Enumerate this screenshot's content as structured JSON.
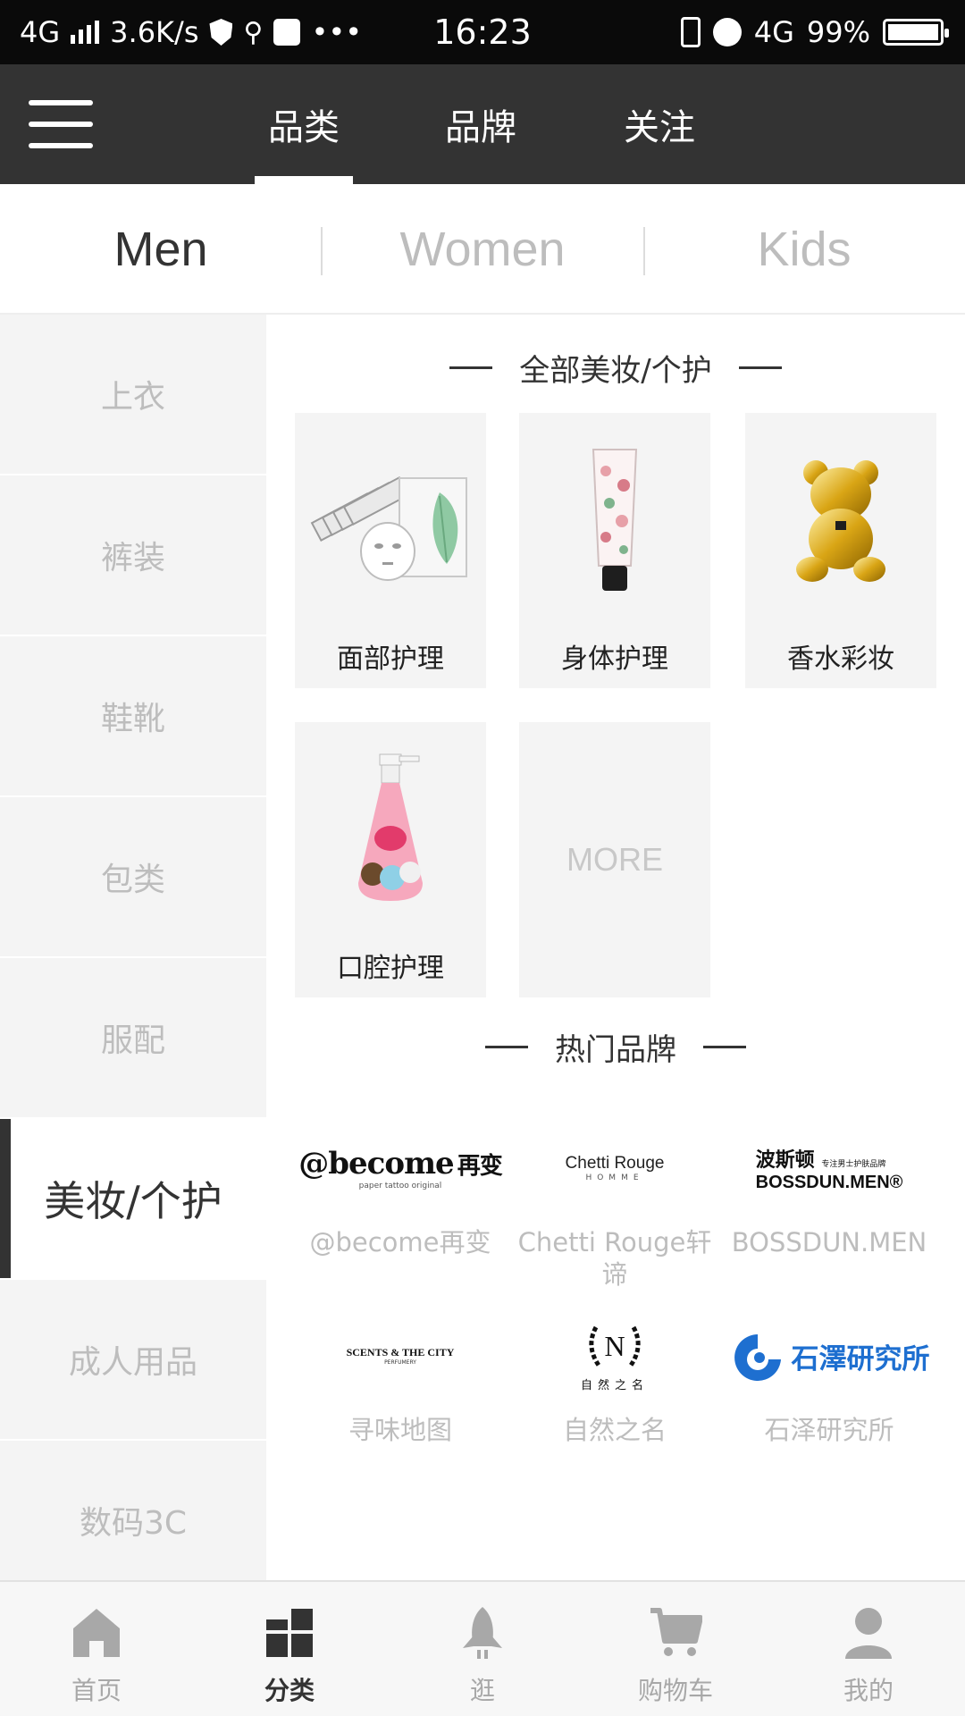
{
  "status_bar": {
    "network": "4G",
    "speed": "3.6K/s",
    "more": "•••",
    "time": "16:23",
    "network_right": "4G",
    "battery": "99%"
  },
  "top_nav": {
    "tabs": [
      {
        "label": "品类",
        "active": true
      },
      {
        "label": "品牌",
        "active": false
      },
      {
        "label": "关注",
        "active": false
      }
    ]
  },
  "gender_tabs": [
    {
      "label": "Men",
      "active": true
    },
    {
      "label": "Women",
      "active": false
    },
    {
      "label": "Kids",
      "active": false
    }
  ],
  "sidebar": {
    "items": [
      {
        "label": "上衣"
      },
      {
        "label": "裤装"
      },
      {
        "label": "鞋靴"
      },
      {
        "label": "包类"
      },
      {
        "label": "服配"
      },
      {
        "label": "美妆/个护",
        "active": true
      },
      {
        "label": "成人用品"
      },
      {
        "label": "数码3C"
      }
    ]
  },
  "main": {
    "category_section_title": "全部美妆/个护",
    "categories": [
      {
        "label": "面部护理",
        "image": "face-mask-product"
      },
      {
        "label": "身体护理",
        "image": "hand-cream-tube"
      },
      {
        "label": "香水彩妆",
        "image": "gold-bear-perfume"
      },
      {
        "label": "口腔护理",
        "image": "toothpaste-pump-bottle"
      }
    ],
    "more_label": "MORE",
    "brands_section_title": "热门品牌",
    "brands": [
      {
        "name": "@become再变",
        "logo_text": "@become",
        "logo_cn": "再变",
        "logo_sub": "paper tattoo original"
      },
      {
        "name": "Chetti Rouge轩谛",
        "logo_text": "Chetti Rouge",
        "logo_sub": "HOMME"
      },
      {
        "name": "BOSSDUN.MEN",
        "logo_text": "BOSSDUN.MEN®",
        "logo_cn": "波斯顿",
        "logo_sub": "专注男士护肤品牌"
      },
      {
        "name": "寻味地图",
        "logo_text": "SCENTS & THE CITY",
        "logo_sub": "PERFUMERY"
      },
      {
        "name": "自然之名",
        "logo_text": "N",
        "logo_cn": "自然之名"
      },
      {
        "name": "石泽研究所",
        "logo_cn": "石澤研究所"
      }
    ]
  },
  "tab_bar": {
    "items": [
      {
        "label": "首页",
        "icon": "home-icon"
      },
      {
        "label": "分类",
        "icon": "category-icon",
        "active": true
      },
      {
        "label": "逛",
        "icon": "rocket-icon"
      },
      {
        "label": "购物车",
        "icon": "cart-icon"
      },
      {
        "label": "我的",
        "icon": "user-icon"
      }
    ]
  },
  "colors": {
    "nav_bg": "#333333",
    "sidebar_bg": "#f4f4f4",
    "inactive_text": "#bdbdbd",
    "accent_blue": "#1e6fd0"
  }
}
